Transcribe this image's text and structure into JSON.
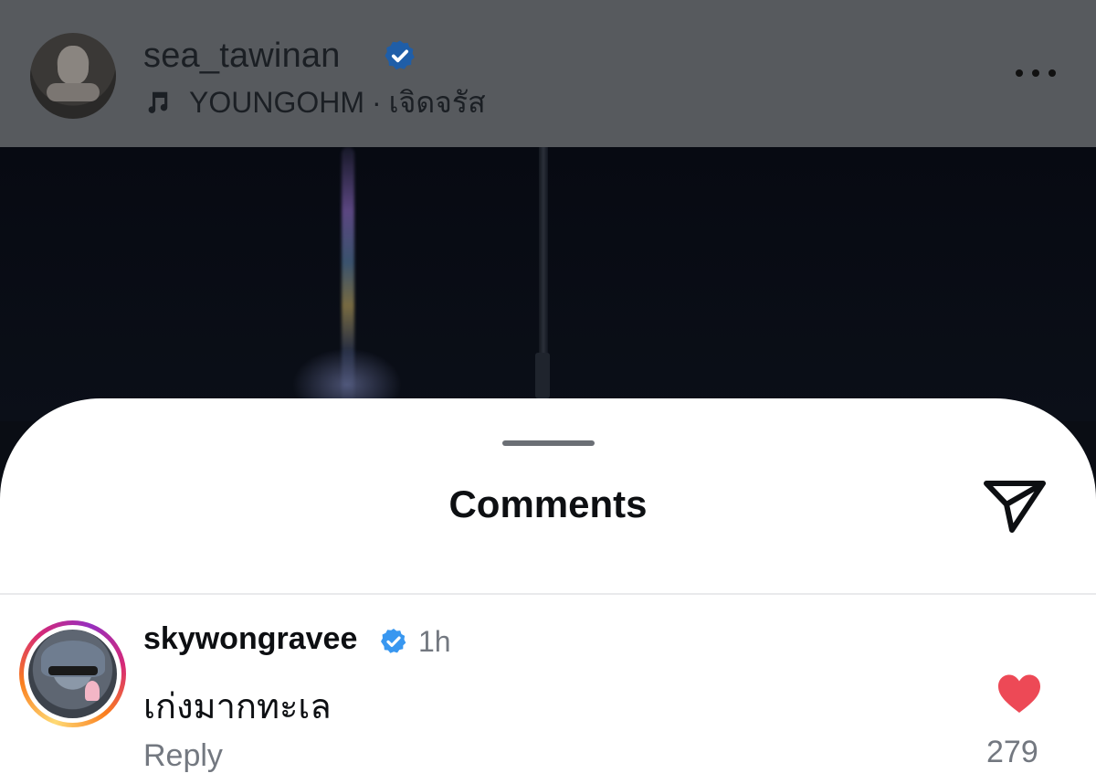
{
  "post_header": {
    "username": "sea_tawinan",
    "music": {
      "artist": "YOUNGOHM",
      "separator": "·",
      "song": "เจิดจรัส"
    },
    "icons": {
      "verified": "verified-badge-icon",
      "music": "music-note-icon",
      "more": "more-options-icon"
    }
  },
  "comments_sheet": {
    "title": "Comments",
    "icons": {
      "share": "send-icon"
    }
  },
  "comments": [
    {
      "username": "skywongravee",
      "verified": true,
      "time": "1h",
      "text": "เก่งมากทะเล",
      "reply_label": "Reply",
      "likes": "279",
      "liked": true
    }
  ],
  "colors": {
    "verified_blue": "#3897f0",
    "like_red": "#ed4956",
    "header_dim": "#575a5e"
  }
}
